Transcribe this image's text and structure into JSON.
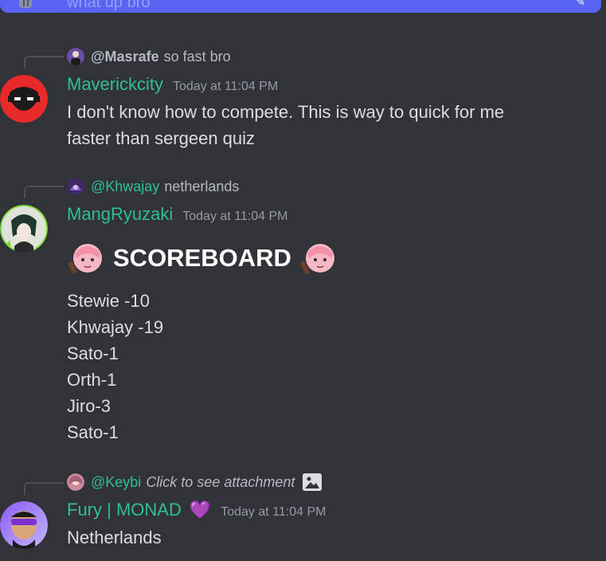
{
  "top": {
    "previous_text": "what up bro"
  },
  "messages": [
    {
      "reply_to": "@Masrafe",
      "reply_text": "so fast bro",
      "username": "Maverickcity",
      "timestamp": "Today at 11:04 PM",
      "lines": [
        "I don't know how to compete. This is way to quick for me",
        "faster than sergeen quiz"
      ]
    },
    {
      "reply_to": "@Khwajay",
      "reply_text": "netherlands",
      "username": "MangRyuzaki",
      "timestamp": "Today at 11:04 PM",
      "heading": "SCOREBOARD",
      "lines": [
        "Stewie -10",
        "Khwajay -19",
        "Sato-1",
        "Orth-1",
        "Jiro-3",
        "Sato-1"
      ]
    },
    {
      "reply_to": "@Keybi",
      "reply_text": "Click to see attachment",
      "username": "Fury | MONAD",
      "badge": "💜",
      "timestamp": "Today at 11:04 PM",
      "lines": [
        "Netherlands"
      ]
    }
  ],
  "icons": {
    "reply_image": "image-icon",
    "heading_emoji": "anime-girl-emoji",
    "badge": "purple-heart-icon"
  },
  "colors": {
    "background": "#313338",
    "username": "#2fbf91",
    "timestamp": "#949ba4",
    "accent_bar": "#5865f2"
  }
}
